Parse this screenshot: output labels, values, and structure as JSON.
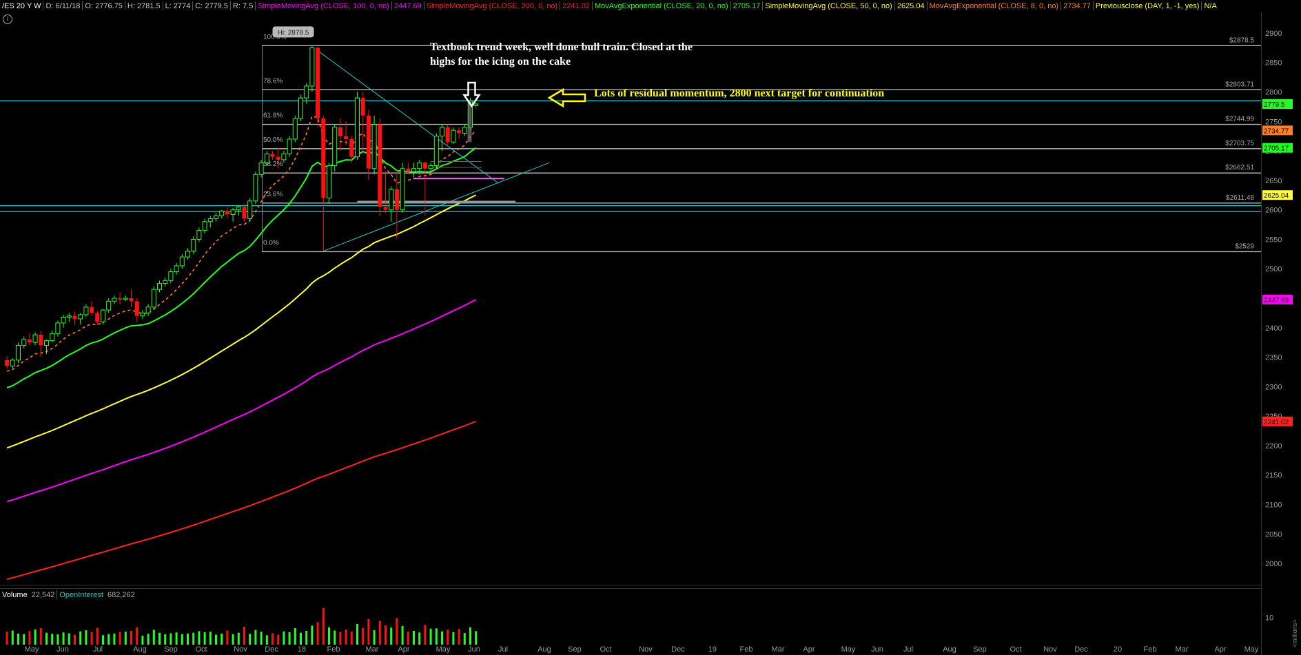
{
  "header": {
    "symbol": "/ES 20 Y W",
    "date": "D: 6/11/18",
    "open": "O: 2776.75",
    "high": "H: 2781.5",
    "low": "L: 2774",
    "close": "C: 2779.5",
    "range": "R: 7.5",
    "studies": [
      {
        "label": "SimpleMovingAvg (CLOSE, 100, 0, no)",
        "value": "2447.69",
        "color": "#ff00ff"
      },
      {
        "label": "SimpleMovingAvg (CLOSE, 200, 0, no)",
        "value": "2241.02",
        "color": "#ff2222"
      },
      {
        "label": "MovAvgExponential (CLOSE, 20, 0, no)",
        "value": "2705.17",
        "color": "#22ff22"
      },
      {
        "label": "SimpleMovingAvg (CLOSE, 50, 0, no)",
        "value": "2625.04",
        "color": "#ffff33"
      },
      {
        "label": "MovAvgExponential (CLOSE, 8, 0, no)",
        "value": "2734.77",
        "color": "#ff7f27"
      },
      {
        "label": "Previousclose (DAY, 1, -1, yes)",
        "value": "N/A",
        "color": "#ffff33"
      }
    ]
  },
  "annotations": {
    "main_line1": "Textbook trend week, well done bull train. Closed at the",
    "main_line2": "highs for the icing on the cake",
    "target": "Lots of residual momentum, 2800 next target for continuation",
    "hi_bubble": "Hi: 2878.5"
  },
  "colors": {
    "up": "#22ff22",
    "down": "#ff1111",
    "ema20": "#22ff22",
    "sma50": "#ffff33",
    "sma100": "#ff00ff",
    "sma200": "#ff2222",
    "ema8": "#ff7f27",
    "cyan": "#22cccc",
    "level": "#c0c0c0"
  },
  "volume": {
    "label": "Volume",
    "value": "22,542",
    "oi_label": "OpenInterest",
    "oi_value": "682,262",
    "tick": "10",
    "units": "<millions>"
  },
  "chart_data": {
    "type": "candlestick",
    "x_axis_labels": [
      "May",
      "Jun",
      "Jul",
      "Aug",
      "Sep",
      "Oct",
      "Nov",
      "Dec",
      "18",
      "Feb",
      "Mar",
      "Apr",
      "May",
      "Jun",
      "Jul",
      "Aug",
      "Sep",
      "Oct",
      "Nov",
      "Dec",
      "19",
      "Feb",
      "Mar",
      "Apr",
      "May",
      "Jun",
      "Jul",
      "Aug",
      "Sep",
      "Oct",
      "Nov",
      "Dec",
      "20",
      "Feb",
      "Mar",
      "Apr",
      "May"
    ],
    "y_ticks": [
      2000,
      2050,
      2100,
      2150,
      2200,
      2250,
      2300,
      2350,
      2400,
      2450,
      2500,
      2550,
      2600,
      2650,
      2700,
      2750,
      2800,
      2850,
      2900
    ],
    "ylim": [
      1965,
      2935
    ],
    "last_price": 2779.5,
    "ma_tags": [
      {
        "value": 2734.77,
        "label": "2734.77",
        "color": "#ff7f27"
      },
      {
        "value": 2705.17,
        "label": "2705.17",
        "color": "#22ff22"
      },
      {
        "value": 2625.04,
        "label": "2625.04",
        "color": "#ffff33"
      },
      {
        "value": 2447.69,
        "label": "2447.69",
        "color": "#ff00ff"
      },
      {
        "value": 2241.02,
        "label": "2241.02",
        "color": "#ff2222"
      }
    ],
    "fib_levels": [
      {
        "pct": "100.0%",
        "price": 2878.5,
        "label": "$2878.5"
      },
      {
        "pct": "78.6%",
        "price": 2803.71,
        "label": "$2803.71"
      },
      {
        "pct": "61.8%",
        "price": 2744.99,
        "label": "$2744.99"
      },
      {
        "pct": "50.0%",
        "price": 2703.75,
        "label": "$2703.75"
      },
      {
        "pct": "38.2%",
        "price": 2662.51,
        "label": "$2662.51"
      },
      {
        "pct": "23.6%",
        "price": 2611.48,
        "label": "$2611.48"
      },
      {
        "pct": "0.0%",
        "price": 2529,
        "label": "$2529"
      }
    ],
    "horizontal_cyan_levels": [
      2785,
      2607,
      2597
    ],
    "candles": [
      [
        2345,
        2352,
        2330,
        2335
      ],
      [
        2335,
        2348,
        2330,
        2345
      ],
      [
        2345,
        2375,
        2340,
        2370
      ],
      [
        2370,
        2385,
        2365,
        2380
      ],
      [
        2380,
        2390,
        2370,
        2375
      ],
      [
        2375,
        2392,
        2370,
        2388
      ],
      [
        2388,
        2395,
        2350,
        2370
      ],
      [
        2370,
        2380,
        2355,
        2378
      ],
      [
        2378,
        2395,
        2375,
        2390
      ],
      [
        2390,
        2412,
        2385,
        2408
      ],
      [
        2408,
        2422,
        2400,
        2418
      ],
      [
        2418,
        2425,
        2410,
        2420
      ],
      [
        2420,
        2428,
        2405,
        2415
      ],
      [
        2415,
        2425,
        2405,
        2422
      ],
      [
        2422,
        2440,
        2418,
        2435
      ],
      [
        2435,
        2445,
        2420,
        2425
      ],
      [
        2425,
        2428,
        2405,
        2410
      ],
      [
        2410,
        2432,
        2405,
        2430
      ],
      [
        2430,
        2450,
        2425,
        2445
      ],
      [
        2445,
        2455,
        2440,
        2450
      ],
      [
        2450,
        2460,
        2440,
        2448
      ],
      [
        2448,
        2455,
        2445,
        2450
      ],
      [
        2450,
        2465,
        2435,
        2445
      ],
      [
        2445,
        2450,
        2410,
        2420
      ],
      [
        2420,
        2430,
        2415,
        2425
      ],
      [
        2425,
        2440,
        2420,
        2435
      ],
      [
        2435,
        2470,
        2430,
        2465
      ],
      [
        2465,
        2480,
        2460,
        2475
      ],
      [
        2475,
        2485,
        2470,
        2480
      ],
      [
        2480,
        2500,
        2475,
        2495
      ],
      [
        2495,
        2510,
        2490,
        2505
      ],
      [
        2505,
        2525,
        2500,
        2520
      ],
      [
        2520,
        2535,
        2515,
        2530
      ],
      [
        2530,
        2555,
        2525,
        2550
      ],
      [
        2550,
        2570,
        2545,
        2565
      ],
      [
        2565,
        2585,
        2560,
        2580
      ],
      [
        2580,
        2590,
        2570,
        2585
      ],
      [
        2585,
        2595,
        2580,
        2590
      ],
      [
        2590,
        2600,
        2585,
        2598
      ],
      [
        2598,
        2605,
        2585,
        2592
      ],
      [
        2592,
        2603,
        2580,
        2600
      ],
      [
        2600,
        2608,
        2590,
        2605
      ],
      [
        2605,
        2610,
        2580,
        2585
      ],
      [
        2585,
        2620,
        2580,
        2615
      ],
      [
        2615,
        2665,
        2610,
        2660
      ],
      [
        2660,
        2685,
        2655,
        2680
      ],
      [
        2680,
        2700,
        2675,
        2695
      ],
      [
        2695,
        2700,
        2685,
        2690
      ],
      [
        2690,
        2705,
        2670,
        2685
      ],
      [
        2685,
        2700,
        2680,
        2695
      ],
      [
        2695,
        2725,
        2690,
        2720
      ],
      [
        2720,
        2760,
        2715,
        2755
      ],
      [
        2755,
        2795,
        2750,
        2790
      ],
      [
        2790,
        2815,
        2780,
        2810
      ],
      [
        2810,
        2878,
        2800,
        2875
      ],
      [
        2875,
        2878,
        2740,
        2755
      ],
      [
        2755,
        2760,
        2530,
        2620
      ],
      [
        2620,
        2680,
        2610,
        2675
      ],
      [
        2675,
        2745,
        2665,
        2740
      ],
      [
        2740,
        2755,
        2700,
        2725
      ],
      [
        2725,
        2750,
        2710,
        2720
      ],
      [
        2720,
        2725,
        2680,
        2690
      ],
      [
        2690,
        2800,
        2685,
        2790
      ],
      [
        2790,
        2800,
        2700,
        2760
      ],
      [
        2760,
        2770,
        2650,
        2670
      ],
      [
        2670,
        2760,
        2660,
        2745
      ],
      [
        2745,
        2755,
        2590,
        2605
      ],
      [
        2605,
        2665,
        2595,
        2600
      ],
      [
        2600,
        2640,
        2580,
        2635
      ],
      [
        2635,
        2670,
        2550,
        2600
      ],
      [
        2600,
        2680,
        2595,
        2670
      ],
      [
        2670,
        2680,
        2660,
        2665
      ],
      [
        2665,
        2680,
        2655,
        2670
      ],
      [
        2670,
        2685,
        2660,
        2680
      ],
      [
        2680,
        2682,
        2590,
        2670
      ],
      [
        2670,
        2680,
        2665,
        2675
      ],
      [
        2675,
        2730,
        2670,
        2725
      ],
      [
        2725,
        2745,
        2700,
        2740
      ],
      [
        2740,
        2745,
        2710,
        2715
      ],
      [
        2715,
        2740,
        2712,
        2735
      ],
      [
        2735,
        2740,
        2720,
        2730
      ],
      [
        2730,
        2745,
        2725,
        2740
      ],
      [
        2740,
        2790,
        2735,
        2785
      ],
      [
        2776.75,
        2781.5,
        2774,
        2779.5
      ]
    ],
    "volume_millions": [
      4.8,
      5.2,
      4.1,
      3.9,
      5.0,
      5.6,
      6.1,
      4.4,
      4.0,
      3.8,
      4.5,
      4.2,
      3.6,
      4.9,
      5.3,
      4.7,
      6.2,
      3.5,
      3.9,
      4.1,
      4.6,
      4.8,
      5.1,
      6.4,
      3.3,
      4.0,
      5.5,
      4.4,
      3.8,
      4.2,
      4.5,
      3.9,
      4.1,
      4.4,
      5.0,
      4.6,
      4.8,
      3.7,
      4.1,
      5.2,
      3.9,
      4.4,
      6.6,
      4.0,
      5.4,
      4.8,
      3.5,
      4.2,
      3.7,
      4.9,
      4.6,
      6.1,
      4.4,
      5.1,
      7.0,
      8.3,
      13.5,
      6.4,
      5.2,
      4.7,
      5.6,
      4.9,
      7.6,
      6.2,
      9.4,
      5.3,
      8.8,
      7.1,
      6.3,
      9.8,
      6.9,
      4.8,
      5.1,
      4.5,
      7.3,
      5.9,
      6.0,
      4.9,
      5.5,
      4.6,
      5.8,
      4.3,
      6.4,
      5.0
    ]
  }
}
